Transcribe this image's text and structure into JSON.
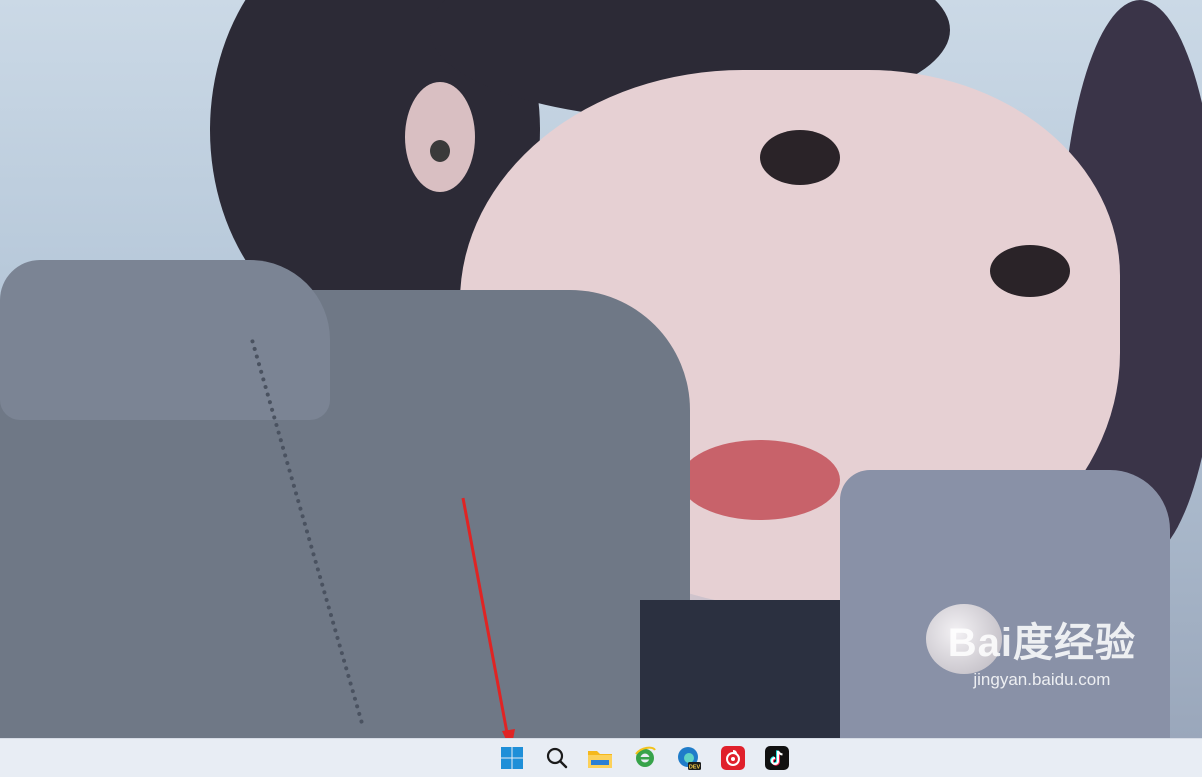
{
  "watermark": {
    "brand": "Bai度经验",
    "url": "jingyan.baidu.com"
  },
  "taskbar": {
    "icons": [
      {
        "name": "windows-start-icon"
      },
      {
        "name": "search-icon"
      },
      {
        "name": "file-explorer-icon"
      },
      {
        "name": "ie-browser-icon"
      },
      {
        "name": "edge-dev-icon",
        "badge": "DEV"
      },
      {
        "name": "netease-music-icon"
      },
      {
        "name": "tiktok-icon"
      }
    ]
  },
  "colors": {
    "taskbar_bg": "#e8edf4",
    "arrow": "#e02424",
    "windows_blue": "#1e8fd8"
  }
}
